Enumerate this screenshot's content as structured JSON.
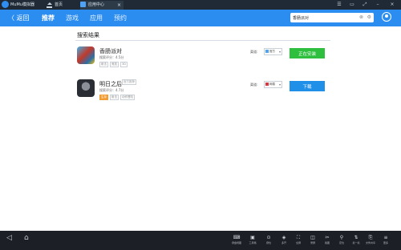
{
  "titlebar": {
    "app_title": "MuMu模拟器",
    "tabs": [
      {
        "label": "首页",
        "icon": "home-icon"
      },
      {
        "label": "应用中心",
        "icon": "app-center-icon"
      }
    ],
    "close_glyph": "×",
    "window_controls": [
      "☰",
      "▭",
      "⤢",
      "–",
      "×"
    ]
  },
  "nav": {
    "back_label": "〈 返回",
    "tabs": [
      "推荐",
      "游戏",
      "应用",
      "预约"
    ],
    "search_value": "香肠派对"
  },
  "results": {
    "title": "搜索结果",
    "source_label": "渠道:",
    "items": [
      {
        "name": "香肠派对",
        "rating": "搜索评分：4.5分",
        "tags": [
          "射击",
          "竞技",
          "3D"
        ],
        "pill": "",
        "source": "官方",
        "source_color": "#4fa3f7",
        "button": "正在安装",
        "button_color": "green"
      },
      {
        "name": "明日之后",
        "rating": "搜索评分：4.7分",
        "tags": [
          "生存",
          "射击",
          "动作冒险"
        ],
        "pill": "官方推荐",
        "source": "网易",
        "source_color": "#d9363e",
        "button": "下载",
        "button_color": "blue"
      }
    ]
  },
  "bottombar": {
    "back_glyph": "◁",
    "home_glyph": "⌂",
    "tools": [
      {
        "glyph": "⌨",
        "label": "键盘视图"
      },
      {
        "glyph": "▣",
        "label": "工具箱"
      },
      {
        "glyph": "⊙",
        "label": "键位"
      },
      {
        "glyph": "◈",
        "label": "多开"
      },
      {
        "glyph": "⛶",
        "label": "全屏"
      },
      {
        "glyph": "◫",
        "label": "录屏"
      },
      {
        "glyph": "✂",
        "label": "截图"
      },
      {
        "glyph": "⚲",
        "label": "定位"
      },
      {
        "glyph": "⇅",
        "label": "摇一摇"
      },
      {
        "glyph": "⎘",
        "label": "文件共享"
      },
      {
        "glyph": "≡",
        "label": "更多"
      }
    ]
  }
}
